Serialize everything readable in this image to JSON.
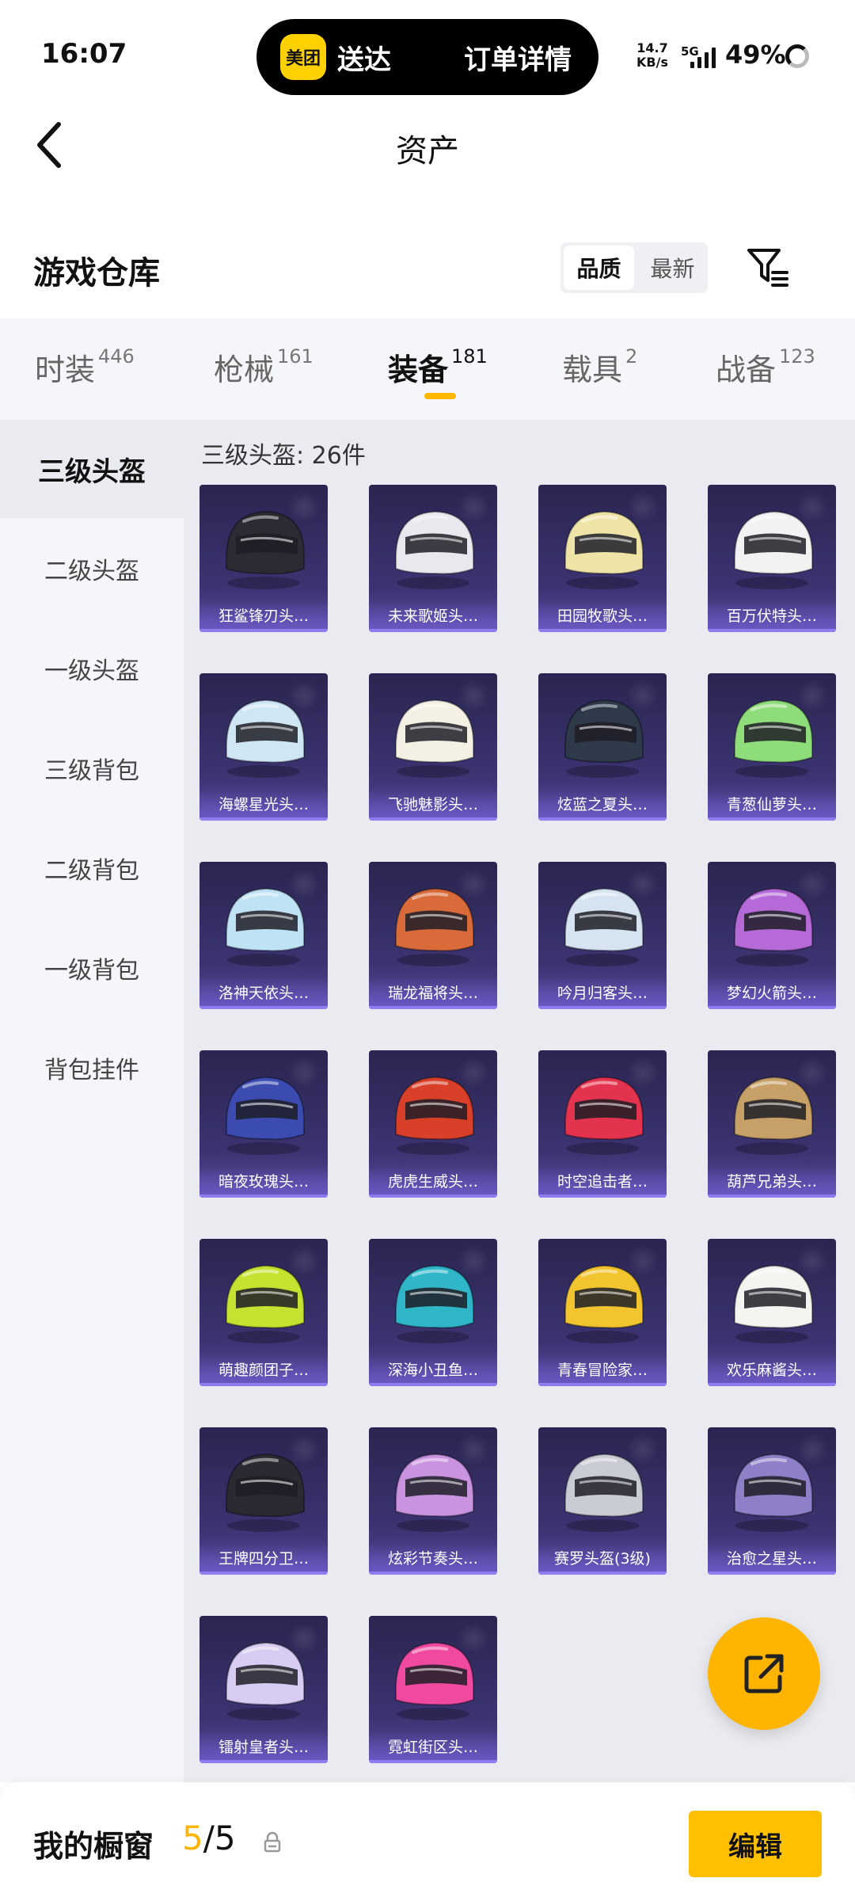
{
  "status_bar": {
    "time": "16:07",
    "pill_logo": "美团",
    "pill_left": "送达",
    "pill_right": "订单详情",
    "net_speed_value": "14.7",
    "net_speed_unit": "KB/s",
    "network": "5G",
    "battery": "49%"
  },
  "header": {
    "title": "资产",
    "back_icon": "chevron-left-icon"
  },
  "section": {
    "title": "游戏仓库",
    "sort_options": [
      "品质",
      "最新"
    ],
    "sort_selected": "品质",
    "filter_icon": "filter-icon"
  },
  "tabs": [
    {
      "label": "时装",
      "count": "446"
    },
    {
      "label": "枪械",
      "count": "161"
    },
    {
      "label": "装备",
      "count": "181",
      "active": true
    },
    {
      "label": "载具",
      "count": "2"
    },
    {
      "label": "战备",
      "count": "123"
    }
  ],
  "sidebar": [
    {
      "label": "三级头盔",
      "active": true
    },
    {
      "label": "二级头盔"
    },
    {
      "label": "一级头盔"
    },
    {
      "label": "三级背包"
    },
    {
      "label": "二级背包"
    },
    {
      "label": "一级背包"
    },
    {
      "label": "背包挂件"
    }
  ],
  "grid": {
    "count_label": "三级头盔: 26件",
    "items": [
      {
        "name": "狂鲨锋刃头…",
        "color": "#2b2b33"
      },
      {
        "name": "未来歌姬头…",
        "color": "#e8e8ee"
      },
      {
        "name": "田园牧歌头…",
        "color": "#efe4a8"
      },
      {
        "name": "百万伏特头…",
        "color": "#f2f2f2"
      },
      {
        "name": "海螺星光头…",
        "color": "#cfe6f5"
      },
      {
        "name": "飞驰魅影头…",
        "color": "#f4f0e4"
      },
      {
        "name": "炫蓝之夏头…",
        "color": "#2e3a4a"
      },
      {
        "name": "青葱仙萝头…",
        "color": "#8fdc7a"
      },
      {
        "name": "洛神天依头…",
        "color": "#bfe3f5"
      },
      {
        "name": "瑞龙福将头…",
        "color": "#d96b3a"
      },
      {
        "name": "吟月归客头…",
        "color": "#d6e4f2"
      },
      {
        "name": "梦幻火箭头…",
        "color": "#b56ad8"
      },
      {
        "name": "暗夜玫瑰头…",
        "color": "#3b4bb0"
      },
      {
        "name": "虎虎生威头…",
        "color": "#d9402a"
      },
      {
        "name": "时空追击者…",
        "color": "#e3334f"
      },
      {
        "name": "葫芦兄弟头…",
        "color": "#c7a067"
      },
      {
        "name": "萌趣颜团子…",
        "color": "#c3e330"
      },
      {
        "name": "深海小丑鱼…",
        "color": "#2fb7c9"
      },
      {
        "name": "青春冒险家…",
        "color": "#f2c530"
      },
      {
        "name": "欢乐麻酱头…",
        "color": "#f4f4f0"
      },
      {
        "name": "王牌四分卫…",
        "color": "#2a2a33"
      },
      {
        "name": "炫彩节奏头…",
        "color": "#c993e0"
      },
      {
        "name": "赛罗头盔(3级)",
        "color": "#c9ccd4"
      },
      {
        "name": "治愈之星头…",
        "color": "#8e7fc8"
      },
      {
        "name": "镭射皇者头…",
        "color": "#d8ccf2"
      },
      {
        "name": "霓虹街区头…",
        "color": "#f04aa0"
      }
    ]
  },
  "fab": {
    "icon": "share-external-icon"
  },
  "bottom_bar": {
    "label": "我的橱窗",
    "current": "5",
    "total": "/5",
    "lock_icon": "lock-icon",
    "edit_label": "编辑"
  },
  "colors": {
    "accent": "#ffb400",
    "card_bg": "#3c3472"
  }
}
